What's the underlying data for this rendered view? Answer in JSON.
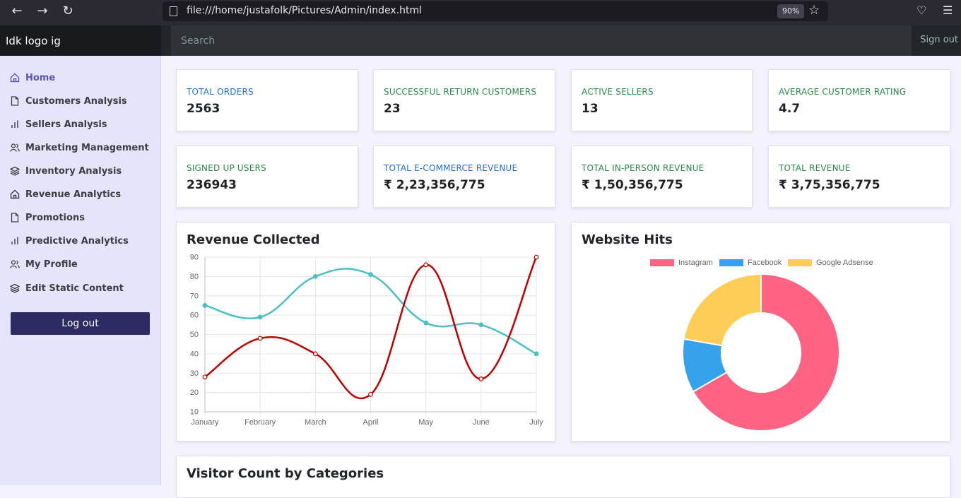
{
  "browser": {
    "url": "file:///home/justafolk/Pictures/Admin/index.html",
    "zoom": "90%"
  },
  "brand": "Idk logo ig",
  "search": {
    "placeholder": "Search"
  },
  "signout": "Sign out",
  "sidebar": {
    "items": [
      {
        "label": "Home",
        "icon": "home-icon",
        "active": true
      },
      {
        "label": "Customers Analysis",
        "icon": "file-icon"
      },
      {
        "label": "Sellers Analysis",
        "icon": "bar-chart-icon"
      },
      {
        "label": "Marketing Management",
        "icon": "users-icon"
      },
      {
        "label": "Inventory Analysis",
        "icon": "layers-icon"
      },
      {
        "label": "Revenue Analytics",
        "icon": "home-icon"
      },
      {
        "label": "Promotions",
        "icon": "file-icon"
      },
      {
        "label": "Predictive Analytics",
        "icon": "bar-chart-icon"
      },
      {
        "label": "My Profile",
        "icon": "users-icon"
      },
      {
        "label": "Edit Static Content",
        "icon": "layers-icon"
      }
    ],
    "logout": "Log out"
  },
  "stats": [
    {
      "label": "TOTAL ORDERS",
      "value": "2563",
      "color": "blue"
    },
    {
      "label": "SUCCESSFUL RETURN CUSTOMERS",
      "value": "23",
      "color": "green"
    },
    {
      "label": "ACTIVE SELLERS",
      "value": "13",
      "color": "green"
    },
    {
      "label": "AVERAGE CUSTOMER RATING",
      "value": "4.7",
      "color": "green"
    },
    {
      "label": "SIGNED UP USERS",
      "value": "236943",
      "color": "green"
    },
    {
      "label": "TOTAL E-COMMERCE REVENUE",
      "value": "₹ 2,23,356,775",
      "color": "blue"
    },
    {
      "label": "TOTAL IN-PERSON REVENUE",
      "value": "₹ 1,50,356,775",
      "color": "green"
    },
    {
      "label": "TOTAL REVENUE",
      "value": "₹ 3,75,356,775",
      "color": "green"
    }
  ],
  "panels": {
    "revenue_title": "Revenue Collected",
    "hits_title": "Website Hits",
    "visitor_title": "Visitor Count by Categories"
  },
  "chart_data": [
    {
      "type": "line",
      "title": "Revenue Collected",
      "categories": [
        "January",
        "February",
        "March",
        "April",
        "May",
        "June",
        "July"
      ],
      "ylim": [
        10,
        90
      ],
      "yticks": [
        10,
        20,
        30,
        40,
        50,
        60,
        70,
        80,
        90
      ],
      "grid": true,
      "series": [
        {
          "values": [
            65,
            59,
            80,
            81,
            56,
            55,
            40
          ],
          "color": "#4bc0c0"
        },
        {
          "values": [
            28,
            48,
            40,
            19,
            86,
            27,
            90
          ],
          "color": "#c00000"
        }
      ]
    },
    {
      "type": "pie",
      "title": "Website Hits",
      "legend": "top",
      "labels": [
        "Instagram",
        "Facebook",
        "Google Adsense"
      ],
      "values": [
        300,
        50,
        100
      ],
      "colors": [
        "#ff6384",
        "#36a2eb",
        "#ffcd56"
      ]
    }
  ]
}
